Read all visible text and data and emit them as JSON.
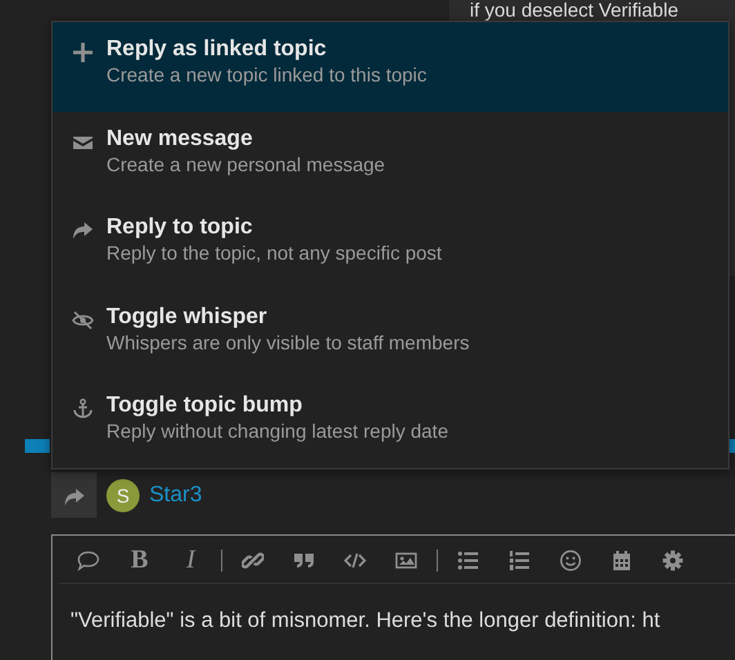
{
  "background_post": {
    "text": "if you deselect Verifiable"
  },
  "menu": {
    "items": [
      {
        "kind": "plus",
        "title": "Reply as linked topic",
        "description": "Create a new topic linked to this topic",
        "selected": true
      },
      {
        "kind": "envelope",
        "title": "New message",
        "description": "Create a new personal message",
        "selected": false
      },
      {
        "kind": "share",
        "title": "Reply to topic",
        "description": "Reply to the topic, not any specific post",
        "selected": false
      },
      {
        "kind": "eye-slash",
        "title": "Toggle whisper",
        "description": "Whispers are only visible to staff members",
        "selected": false
      },
      {
        "kind": "anchor",
        "title": "Toggle topic bump",
        "description": "Reply without changing latest reply date",
        "selected": false
      }
    ]
  },
  "reply_to": {
    "avatar_letter": "S",
    "username": "Star3"
  },
  "editor": {
    "toolbar": [
      {
        "kind": "bubble"
      },
      {
        "kind": "bold",
        "label": "B"
      },
      {
        "kind": "italic",
        "label": "I"
      },
      {
        "kind": "separator"
      },
      {
        "kind": "link"
      },
      {
        "kind": "quote"
      },
      {
        "kind": "code"
      },
      {
        "kind": "image"
      },
      {
        "kind": "separator"
      },
      {
        "kind": "bullets"
      },
      {
        "kind": "numbers"
      },
      {
        "kind": "smiley"
      },
      {
        "kind": "calendar"
      },
      {
        "kind": "gear"
      }
    ],
    "text": "\"Verifiable\" is a bit of misnomer. Here's the longer definition: ht"
  }
}
